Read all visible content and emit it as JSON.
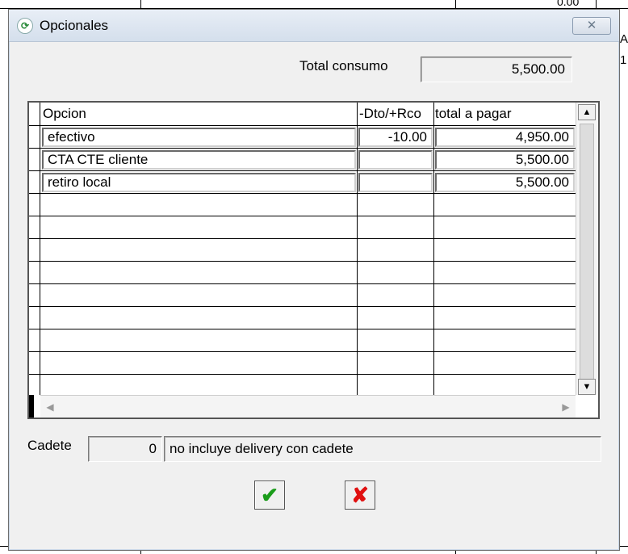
{
  "background": {
    "value_top": "0.00",
    "edge_chars": [
      "A",
      "1"
    ]
  },
  "window": {
    "title": "Opcionales",
    "app_icon": "app-logo-icon",
    "close_icon": "close-icon",
    "close_glyph": "✕"
  },
  "summary": {
    "total_label": "Total consumo",
    "total_value": "5,500.00"
  },
  "grid": {
    "columns": [
      "Opcion",
      "-Dto/+Rco",
      "total a pagar"
    ],
    "rows": [
      {
        "opcion": "efectivo",
        "dto": "-10.00",
        "total": "4,950.00"
      },
      {
        "opcion": "CTA CTE cliente",
        "dto": "",
        "total": "5,500.00"
      },
      {
        "opcion": "retiro local",
        "dto": "",
        "total": "5,500.00"
      }
    ],
    "scroll_up": "▲",
    "scroll_down": "▼",
    "scroll_left": "◀",
    "scroll_right": "▶"
  },
  "cadete": {
    "label": "Cadete",
    "number": "0",
    "description": "no incluye delivery con cadete"
  },
  "buttons": {
    "confirm": {
      "icon": "checkmark-icon",
      "glyph": "✔",
      "color": "#1a9c1a"
    },
    "cancel": {
      "icon": "x-mark-icon",
      "glyph": "✘",
      "color": "#e01010"
    }
  }
}
